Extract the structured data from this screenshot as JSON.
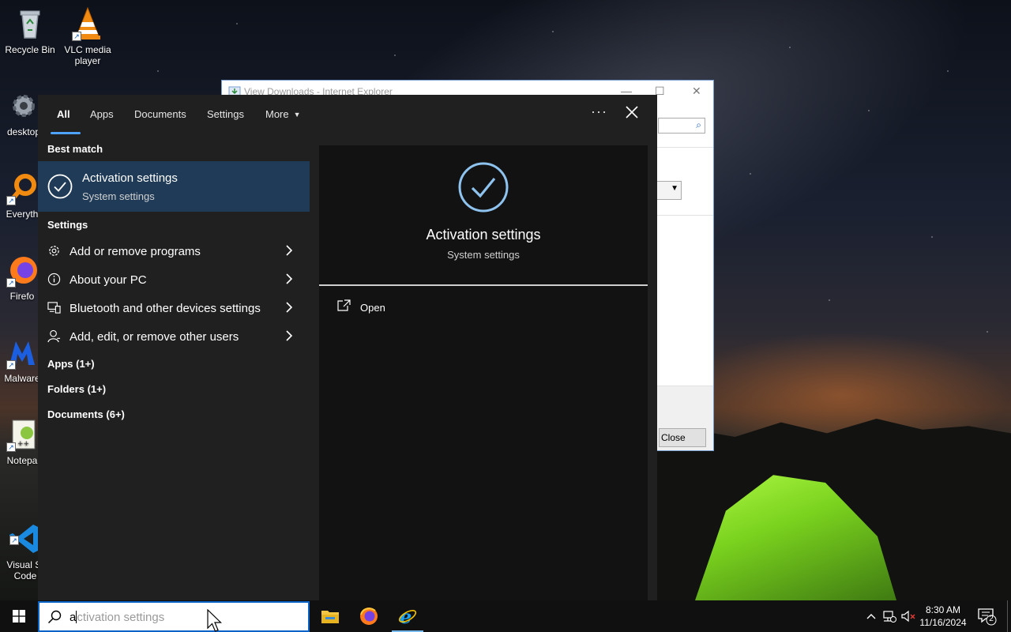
{
  "desktop": {
    "icons": [
      {
        "label": "Recycle Bin",
        "icon": "recycle-bin-icon"
      },
      {
        "label": "VLC media player",
        "icon": "vlc-icon"
      },
      {
        "label": "desktop",
        "icon": "gear-icon"
      },
      {
        "label": "Everyth",
        "icon": "everything-search-icon"
      },
      {
        "label": "Firefo",
        "icon": "firefox-icon"
      },
      {
        "label": "Malware",
        "icon": "malwarebytes-icon"
      },
      {
        "label": "Notepa",
        "icon": "notepad-plus-plus-icon"
      },
      {
        "label": "Visual St\nCode",
        "icon": "vscode-icon"
      }
    ]
  },
  "background_window": {
    "title": "View Downloads - Internet Explorer",
    "close_button": "Close"
  },
  "search_panel": {
    "tabs": [
      {
        "label": "All",
        "active": true
      },
      {
        "label": "Apps",
        "active": false
      },
      {
        "label": "Documents",
        "active": false
      },
      {
        "label": "Settings",
        "active": false
      },
      {
        "label": "More",
        "active": false
      }
    ],
    "more_options": "···",
    "best_match_heading": "Best match",
    "best_match": {
      "title": "Activation settings",
      "subtitle": "System settings",
      "icon": "check-circle-icon"
    },
    "settings_heading": "Settings",
    "settings_items": [
      {
        "label": "Add or remove programs",
        "icon": "gear-icon"
      },
      {
        "label": "About your PC",
        "icon": "info-icon"
      },
      {
        "label": "Bluetooth and other devices settings",
        "icon": "devices-icon"
      },
      {
        "label": "Add, edit, or remove other users",
        "icon": "person-icon"
      }
    ],
    "groups": [
      {
        "label": "Apps (1+)"
      },
      {
        "label": "Folders (1+)"
      },
      {
        "label": "Documents (6+)"
      }
    ],
    "preview": {
      "title": "Activation settings",
      "subtitle": "System settings",
      "action_label": "Open",
      "icon": "check-circle-icon"
    }
  },
  "taskbar": {
    "search_typed": "a",
    "search_suggestion": "ctivation settings",
    "pinned_apps": [
      {
        "icon": "file-explorer-icon"
      },
      {
        "icon": "firefox-icon"
      },
      {
        "icon": "internet-explorer-icon"
      }
    ],
    "clock_time": "8:30 AM",
    "clock_date": "11/16/2024",
    "notification_count": "2"
  },
  "colors": {
    "accent": "#4da3ff",
    "best_match_bg": "#1f3b57",
    "panel_bg": "#202020",
    "preview_bg": "#121212",
    "search_border": "#0a64c8"
  }
}
